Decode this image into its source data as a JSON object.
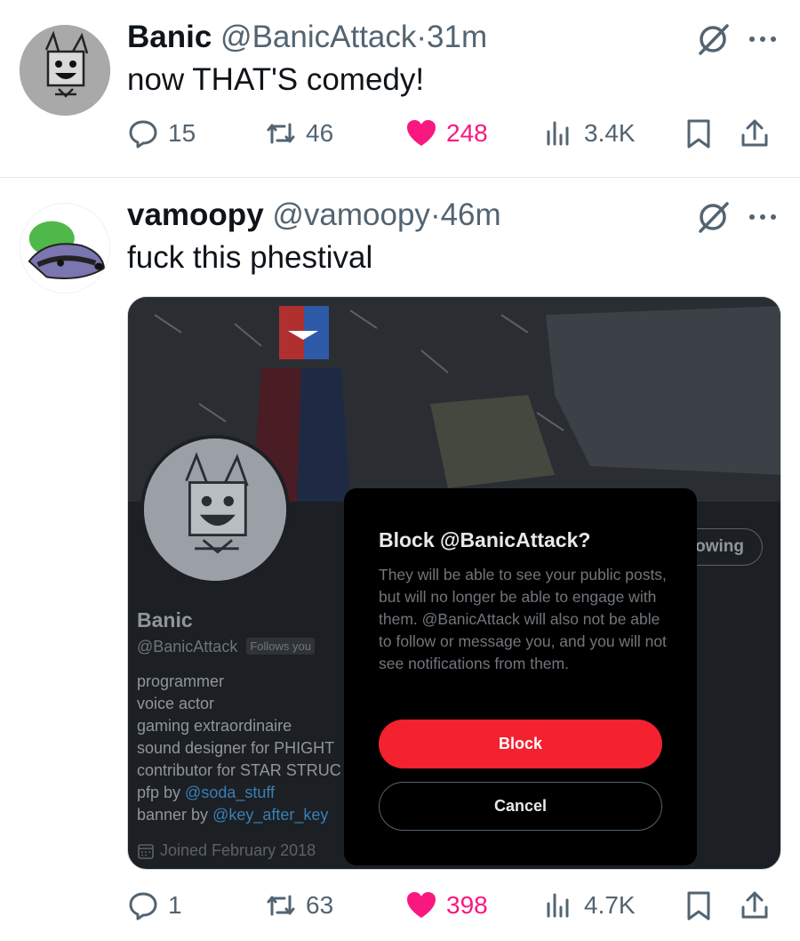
{
  "colors": {
    "like": "#f91880",
    "block_button": "#f4212e",
    "muted": "#536471"
  },
  "tweets": [
    {
      "name": "Banic",
      "handle": "@BanicAttack",
      "dot": "·",
      "time": "31m",
      "text": "now THAT'S comedy!",
      "stats": {
        "replies": "15",
        "reposts": "46",
        "likes": "248",
        "views": "3.4K"
      },
      "icons": [
        "reply-icon",
        "repost-icon",
        "heart-icon",
        "views-icon",
        "bookmark-icon",
        "share-icon",
        "grok-icon",
        "more-icon"
      ]
    },
    {
      "name": "vamoopy",
      "handle": "@vamoopy",
      "dot": "·",
      "time": "46m",
      "text": "fuck this phestival",
      "stats": {
        "replies": "1",
        "reposts": "63",
        "likes": "398",
        "views": "4.7K"
      }
    }
  ],
  "screenshot": {
    "profile_name": "Banic",
    "profile_handle": "@BanicAttack",
    "follows_you": "Follows you",
    "bio": [
      "programmer",
      "voice actor",
      "gaming extraordinaire",
      "sound designer for PHIGHT",
      "contributor for STAR STRUC"
    ],
    "pfp_prefix": "pfp by ",
    "pfp_link": "@soda_stuff",
    "banner_prefix": "banner by ",
    "banner_link": "@key_after_key",
    "joined": "Joined February 2018",
    "following_button": "owing",
    "modal": {
      "title": "Block @BanicAttack?",
      "body": "They will be able to see your public posts, but will no longer be able to engage with them. @BanicAttack will also not be able to follow or message you, and you will not see notifications from them.",
      "block_label": "Block",
      "cancel_label": "Cancel"
    }
  }
}
